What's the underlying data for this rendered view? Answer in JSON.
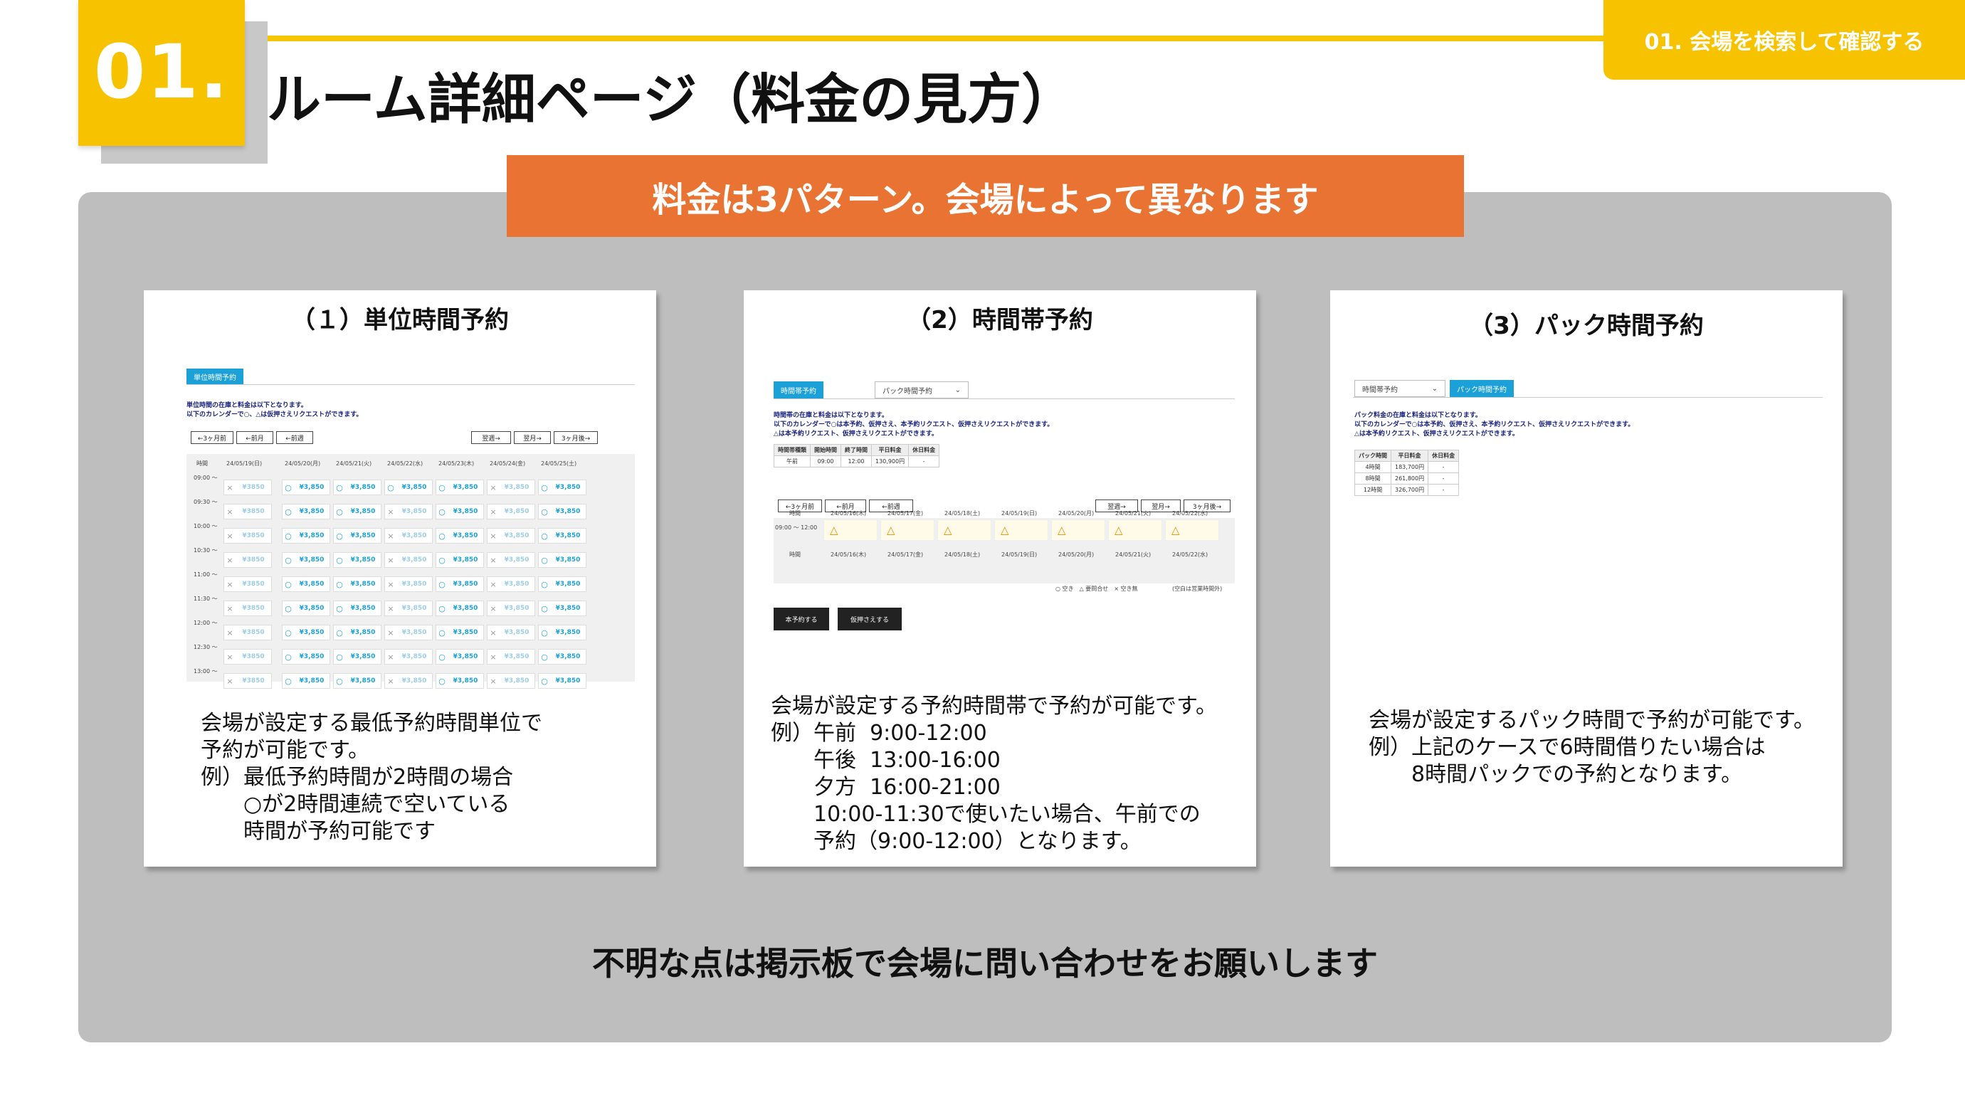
{
  "header": {
    "number": "01.",
    "title": "ルーム詳細ページ（料金の見方）",
    "section_tag": "01. 会場を検索して確認する"
  },
  "banner": "料金は3パターン。会場によって異なります",
  "footer": "不明な点は掲示板で会場に問い合わせをお願いします",
  "colors": {
    "yellow": "#F7C300",
    "orange": "#E97332",
    "panel_gray": "#BEBEBE",
    "tab_blue": "#1BA0D8"
  },
  "cards": [
    {
      "title": "（１）単位時間予約",
      "description": "会場が設定する最低予約時間単位で\n予約が可能です。\n例）最低予約時間が2時間の場合\n　　○が2時間連続で空いている\n　　時間が予約可能です",
      "mini": {
        "tab": "単位時間予約",
        "note": "単位時間の在庫と料金は以下となります。\n以下のカレンダーで○、△は仮押さえリクエストができます。",
        "nav_prev": [
          "←3ヶ月前",
          "←前月",
          "←前週"
        ],
        "nav_next": [
          "翌週→",
          "翌月→",
          "3ヶ月後→"
        ],
        "time_header": "時間",
        "dates": [
          "24/05/19(日)",
          "24/05/20(月)",
          "24/05/21(火)",
          "24/05/22(水)",
          "24/05/23(木)",
          "24/05/24(金)",
          "24/05/25(土)"
        ],
        "times": [
          "09:00 〜",
          "09:30 〜",
          "10:00 〜",
          "10:30 〜",
          "11:00 〜",
          "11:30 〜",
          "12:00 〜",
          "12:30 〜",
          "13:00 〜"
        ],
        "rows": [
          [
            "×¥3850",
            "○¥3,850",
            "○¥3,850",
            "○¥3,850",
            "○¥3,850",
            "×¥3,850",
            "○¥3,850"
          ],
          [
            "×¥3850",
            "○¥3,850",
            "○¥3,850",
            "×¥3,850",
            "○¥3,850",
            "×¥3,850",
            "○¥3,850"
          ],
          [
            "×¥3850",
            "○¥3,850",
            "○¥3,850",
            "×¥3,850",
            "○¥3,850",
            "×¥3,850",
            "○¥3,850"
          ],
          [
            "×¥3850",
            "○¥3,850",
            "○¥3,850",
            "×¥3,850",
            "○¥3,850",
            "×¥3,850",
            "○¥3,850"
          ],
          [
            "×¥3850",
            "○¥3,850",
            "○¥3,850",
            "×¥3,850",
            "○¥3,850",
            "×¥3,850",
            "○¥3,850"
          ],
          [
            "×¥3850",
            "○¥3,850",
            "○¥3,850",
            "×¥3,850",
            "○¥3,850",
            "×¥3,850",
            "○¥3,850"
          ],
          [
            "×¥3850",
            "○¥3,850",
            "○¥3,850",
            "×¥3,850",
            "○¥3,850",
            "×¥3,850",
            "○¥3,850"
          ],
          [
            "×¥3850",
            "○¥3,850",
            "○¥3,850",
            "×¥3,850",
            "○¥3,850",
            "×¥3,850",
            "○¥3,850"
          ],
          [
            "×¥3850",
            "○¥3,850",
            "○¥3,850",
            "×¥3,850",
            "○¥3,850",
            "×¥3,850",
            "○¥3,850"
          ]
        ]
      }
    },
    {
      "title": "（2）時間帯予約",
      "description": "会場が設定する予約時間帯で予約が可能です。\n例）午前  9:00-12:00\n　　午後  13:00-16:00\n　　夕方  16:00-21:00\n　　10:00-11:30で使いたい場合、午前での\n　　予約（9:00-12:00）となります。",
      "mini": {
        "tab_on": "時間帯予約",
        "tab_off": "パック時間予約",
        "note": "時間帯の在庫と料金は以下となります。\n以下のカレンダーで○は本予約、仮押さえ、本予約リクエスト、仮押さえリクエストができます。\n△は本予約リクエスト、仮押さえリクエストができます。",
        "table": [
          [
            "時間帯種類",
            "開始時間",
            "終了時間",
            "平日料金",
            "休日料金"
          ],
          [
            "午前",
            "09:00",
            "12:00",
            "130,900円",
            "-"
          ]
        ],
        "nav_prev": [
          "←3ヶ月前",
          "←前月",
          "←前週"
        ],
        "nav_next": [
          "翌週→",
          "翌月→",
          "3ヶ月後→"
        ],
        "time_header": "時間",
        "dates": [
          "24/05/16(木)",
          "24/05/17(金)",
          "24/05/18(土)",
          "24/05/19(日)",
          "24/05/20(月)",
          "24/05/21(火)",
          "24/05/22(水)"
        ],
        "slot_time": "09:00 〜 12:00",
        "slot_mark": "△",
        "legend": "○ 空き　△ 要問合せ　× 空き無",
        "legend_note": "(空白は営業時間外)",
        "buttons": [
          "本予約する",
          "仮押さえする"
        ]
      }
    },
    {
      "title": "（3）パック時間予約",
      "description": "会場が設定するパック時間で予約が可能です。\n例）上記のケースで6時間借りたい場合は\n　　8時間パックでの予約となります。",
      "mini": {
        "tab_off": "時間帯予約",
        "tab_on": "パック時間予約",
        "note": "パック料金の在庫と料金は以下となります。\n以下のカレンダーで○は本予約、仮押さえ、本予約リクエスト、仮押さえリクエストができます。\n△は本予約リクエスト、仮押さえリクエストができます。",
        "table": [
          [
            "パック時間",
            "平日料金",
            "休日料金"
          ],
          [
            "4時間",
            "183,700円",
            "-"
          ],
          [
            "8時間",
            "261,800円",
            "-"
          ],
          [
            "12時間",
            "326,700円",
            "-"
          ]
        ]
      }
    }
  ]
}
